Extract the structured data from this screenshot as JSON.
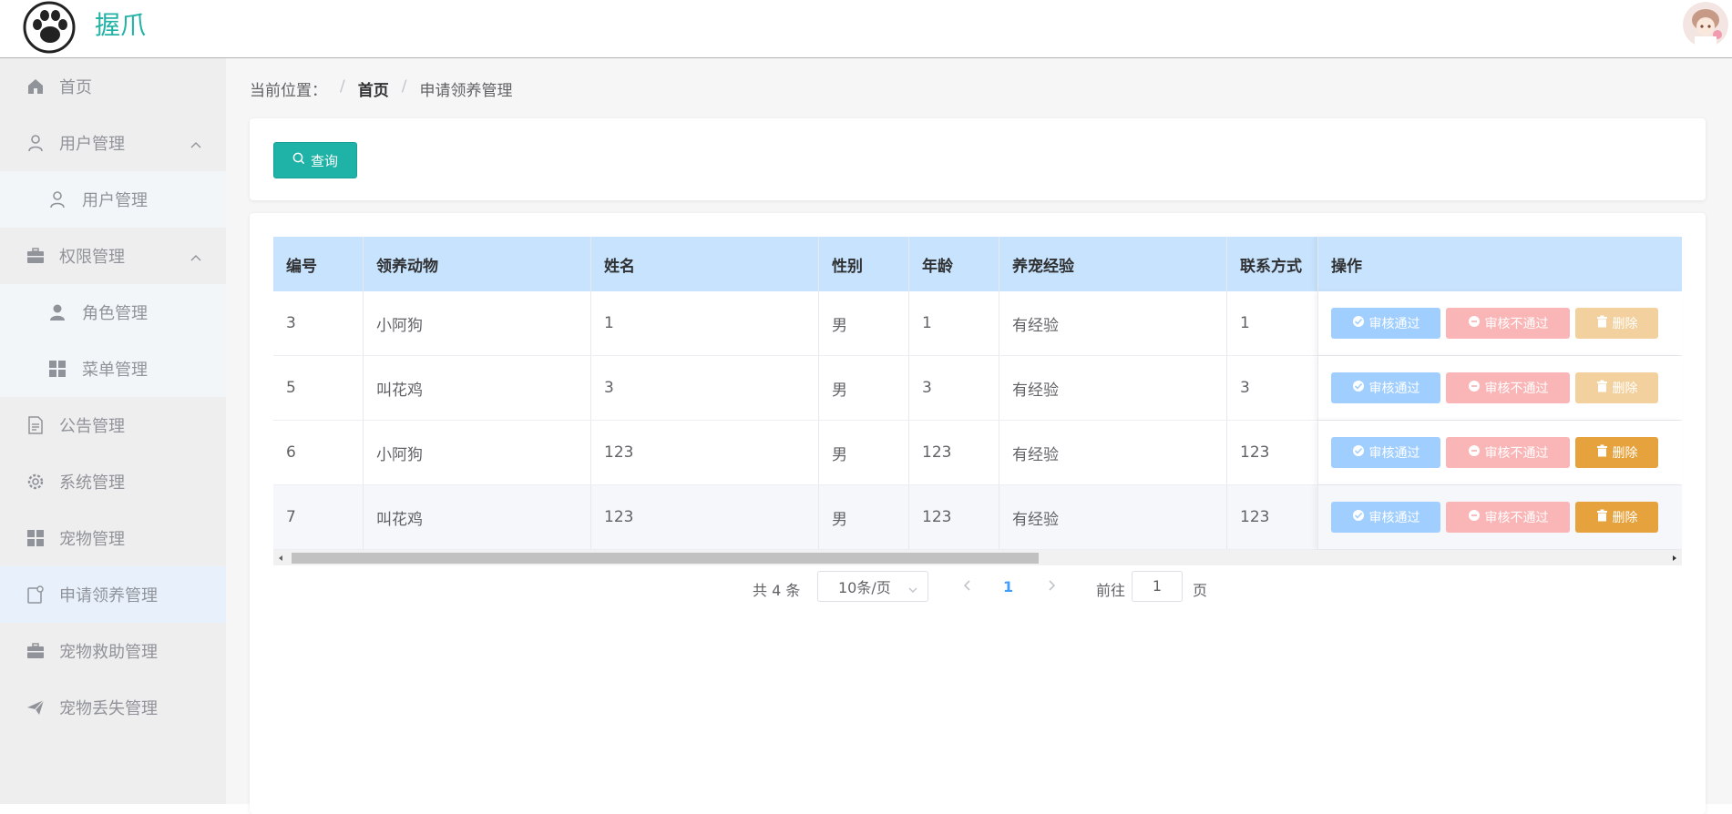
{
  "header": {
    "app_title": "握爪",
    "logo_icon": "paw-icon",
    "avatar_icon": "user-avatar"
  },
  "sidebar": {
    "items": [
      {
        "label": "首页",
        "icon": "home-icon"
      },
      {
        "label": "用户管理",
        "icon": "user-icon",
        "expanded": true
      },
      {
        "label": "用户管理",
        "icon": "user-icon",
        "sub": true
      },
      {
        "label": "权限管理",
        "icon": "briefcase-icon",
        "expanded": true
      },
      {
        "label": "角色管理",
        "icon": "user-solid-icon",
        "sub": true
      },
      {
        "label": "菜单管理",
        "icon": "grid-icon",
        "sub": true
      },
      {
        "label": "公告管理",
        "icon": "document-icon"
      },
      {
        "label": "系统管理",
        "icon": "gear-icon"
      },
      {
        "label": "宠物管理",
        "icon": "grid-icon"
      },
      {
        "label": "申请领养管理",
        "icon": "tablet-icon",
        "active": true
      },
      {
        "label": "宠物救助管理",
        "icon": "briefcase-icon"
      },
      {
        "label": "宠物丢失管理",
        "icon": "send-icon"
      }
    ]
  },
  "breadcrumb": {
    "prefix": "当前位置：",
    "separator": "/",
    "home": "首页",
    "current": "申请领养管理"
  },
  "toolbar": {
    "search_label": "查询"
  },
  "table": {
    "columns": [
      "编号",
      "领养动物",
      "姓名",
      "性别",
      "年龄",
      "养宠经验",
      "联系方式",
      "操作"
    ],
    "rows": [
      {
        "id": "3",
        "animal": "小阿狗",
        "name": "1",
        "gender": "男",
        "age": "1",
        "experience": "有经验",
        "contact": "1",
        "delete_enabled": false
      },
      {
        "id": "5",
        "animal": "叫花鸡",
        "name": "3",
        "gender": "男",
        "age": "3",
        "experience": "有经验",
        "contact": "3",
        "delete_enabled": false
      },
      {
        "id": "6",
        "animal": "小阿狗",
        "name": "123",
        "gender": "男",
        "age": "123",
        "experience": "有经验",
        "contact": "123",
        "delete_enabled": true
      },
      {
        "id": "7",
        "animal": "叫花鸡",
        "name": "123",
        "gender": "男",
        "age": "123",
        "experience": "有经验",
        "contact": "123",
        "delete_enabled": true
      }
    ],
    "actions": {
      "pass_label": "审核通过",
      "fail_label": "审核不通过",
      "delete_label": "删除"
    }
  },
  "pagination": {
    "total_text": "共 4 条",
    "page_size": "10条/页",
    "current_page": "1",
    "goto_label": "前往",
    "goto_value": "1",
    "page_suffix": "页"
  },
  "colors": {
    "brand": "#22b3a6",
    "header_row": "#c8e3fd",
    "pass": "#a0cfff",
    "fail": "#fab6b6",
    "delete_disabled": "#f3d19e",
    "delete_enabled": "#e6a23c"
  }
}
